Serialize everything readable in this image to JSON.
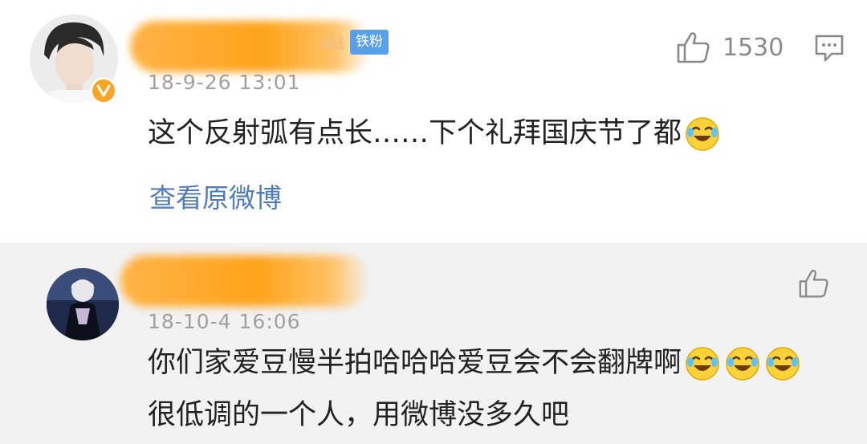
{
  "comments": [
    {
      "timestamp": "18-9-26 13:01",
      "badge": "铁粉",
      "text": "这个反射弧有点长……下个礼拜国庆节了都",
      "view_original": "查看原微博",
      "likes": "1530",
      "emoji": [
        "laugh-cry-emoji"
      ]
    },
    {
      "timestamp": "18-10-4 16:06",
      "text_line1": "你们家爱豆慢半拍哈哈哈爱豆会不会翻牌啊",
      "text_line2": "很低调的一个人，用微博没多久吧",
      "emoji": [
        "laugh-cry-emoji",
        "laugh-cry-emoji",
        "laugh-cry-emoji"
      ]
    }
  ],
  "colors": {
    "link": "#4f7bbd",
    "badge": "#5aa0e6",
    "verified": "#f6a623",
    "redaction": "#ffa31a",
    "second_bg": "#f2f2f2"
  }
}
